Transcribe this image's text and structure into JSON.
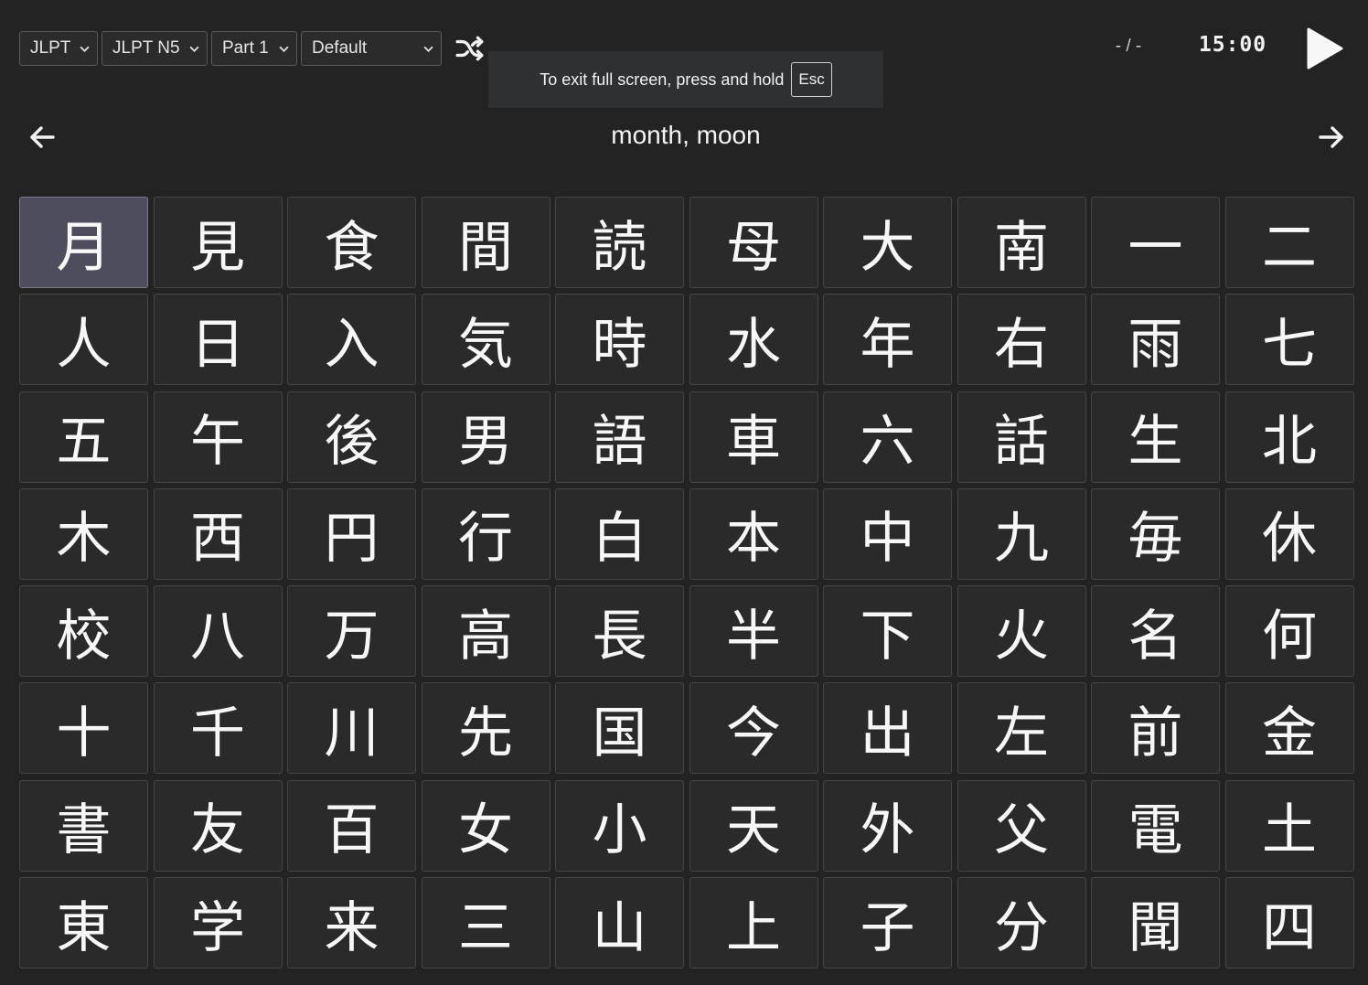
{
  "toolbar": {
    "selects": [
      {
        "name": "category-select",
        "value": "JLPT"
      },
      {
        "name": "level-select",
        "value": "JLPT N5"
      },
      {
        "name": "part-select",
        "value": "Part 1"
      },
      {
        "name": "order-select",
        "value": "Default"
      }
    ],
    "shuffle_icon": "shuffle-icon"
  },
  "status": {
    "progress": "- / -",
    "timer": "15:00",
    "play_icon": "play-icon"
  },
  "fullscreen_notice": {
    "text": "To exit full screen, press and hold",
    "key": "Esc"
  },
  "card": {
    "meaning": "month, moon",
    "prev_icon": "arrow-left-icon",
    "next_icon": "arrow-right-icon"
  },
  "selected_index": 0,
  "kanji": [
    "月",
    "見",
    "食",
    "間",
    "読",
    "母",
    "大",
    "南",
    "一",
    "二",
    "人",
    "日",
    "入",
    "気",
    "時",
    "水",
    "年",
    "右",
    "雨",
    "七",
    "五",
    "午",
    "後",
    "男",
    "語",
    "車",
    "六",
    "話",
    "生",
    "北",
    "木",
    "西",
    "円",
    "行",
    "白",
    "本",
    "中",
    "九",
    "毎",
    "休",
    "校",
    "八",
    "万",
    "高",
    "長",
    "半",
    "下",
    "火",
    "名",
    "何",
    "十",
    "千",
    "川",
    "先",
    "国",
    "今",
    "出",
    "左",
    "前",
    "金",
    "書",
    "友",
    "百",
    "女",
    "小",
    "天",
    "外",
    "父",
    "電",
    "土",
    "東",
    "学",
    "来",
    "三",
    "山",
    "上",
    "子",
    "分",
    "聞",
    "四"
  ],
  "colors": {
    "background": "#232323",
    "cell": "#2a2a2a",
    "cell_selected": "#4d4d5e",
    "text": "#f7f7f7"
  }
}
